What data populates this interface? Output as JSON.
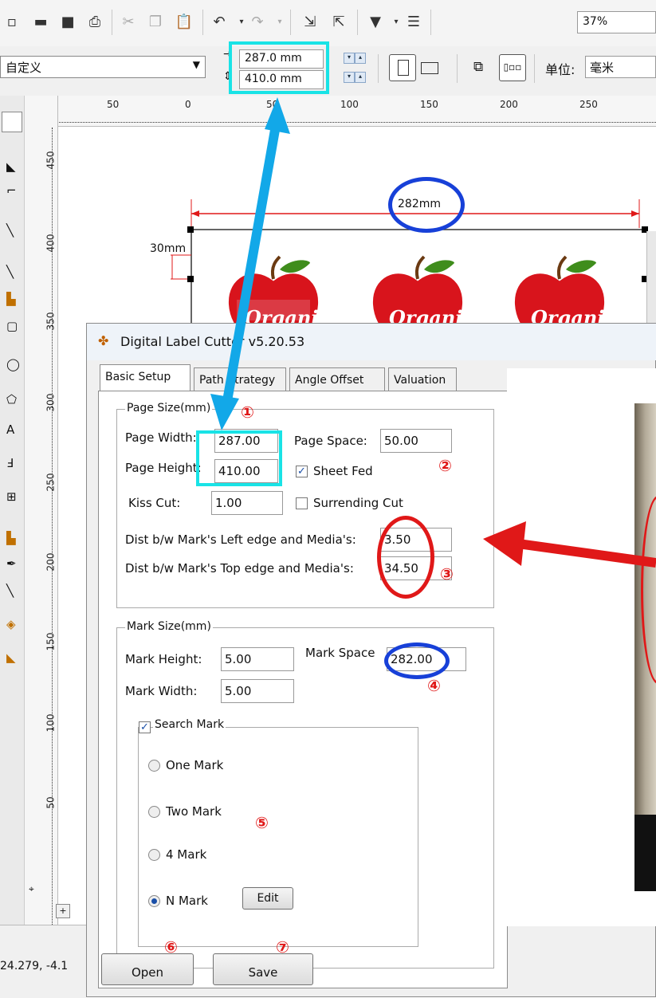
{
  "toolbar": {
    "zoom": "37%",
    "icons": [
      "new-icon",
      "open-icon",
      "save-icon",
      "print-icon",
      "cut-icon",
      "copy-icon",
      "paste-icon",
      "undo-icon",
      "redo-icon",
      "import-icon",
      "export-icon",
      "publish-icon",
      "options-icon"
    ]
  },
  "property_bar": {
    "preset": "自定义",
    "page_width": "287.0 mm",
    "page_height": "410.0 mm",
    "unit_label": "单位:",
    "unit_value": "毫米"
  },
  "ruler_top": [
    "50",
    "0",
    "50",
    "100",
    "150",
    "200",
    "250"
  ],
  "ruler_left": [
    "450",
    "400",
    "350",
    "300",
    "250",
    "200",
    "150",
    "100",
    "50"
  ],
  "canvas": {
    "dim_width": "282mm",
    "dim_height": "30mm",
    "apple_text": "Organic"
  },
  "status": {
    "coords": "24.279, -4.1"
  },
  "dialog": {
    "title": "Digital Label Cutter v5.20.53",
    "tabs": [
      "Basic Setup",
      "Path Strategy",
      "Angle Offset",
      "Valuation"
    ],
    "page_size": {
      "title": "Page Size(mm)",
      "width_label": "Page Width:",
      "width": "287.00",
      "height_label": "Page Height:",
      "height": "410.00",
      "space_label": "Page Space:",
      "space": "50.00",
      "sheet_fed": "Sheet Fed",
      "kiss_cut_label": "Kiss Cut:",
      "kiss_cut": "1.00",
      "surrending": "Surrending Cut",
      "left_edge_label": "Dist b/w Mark's Left edge and Media's:",
      "left_edge": "3.50",
      "top_edge_label": "Dist b/w Mark's Top edge and Media's:",
      "top_edge": "34.50"
    },
    "mark_size": {
      "title": "Mark Size(mm)",
      "height_label": "Mark Height:",
      "height": "5.00",
      "space_label": "Mark Space",
      "space": "282.00",
      "width_label": "Mark Width:",
      "width": "5.00"
    },
    "search_mark": {
      "title": "Search Mark",
      "one": "One Mark",
      "two": "Two Mark",
      "four": "4  Mark",
      "n": "N  Mark",
      "edit": "Edit"
    },
    "open": "Open",
    "save": "Save"
  },
  "annotations": [
    "①",
    "②",
    "③",
    "④",
    "⑤",
    "⑥",
    "⑦"
  ],
  "colors": {
    "cyan": "#19e3e6",
    "blue": "#1740d8",
    "red": "#e01818",
    "arrow_blue": "#12a8e8"
  }
}
